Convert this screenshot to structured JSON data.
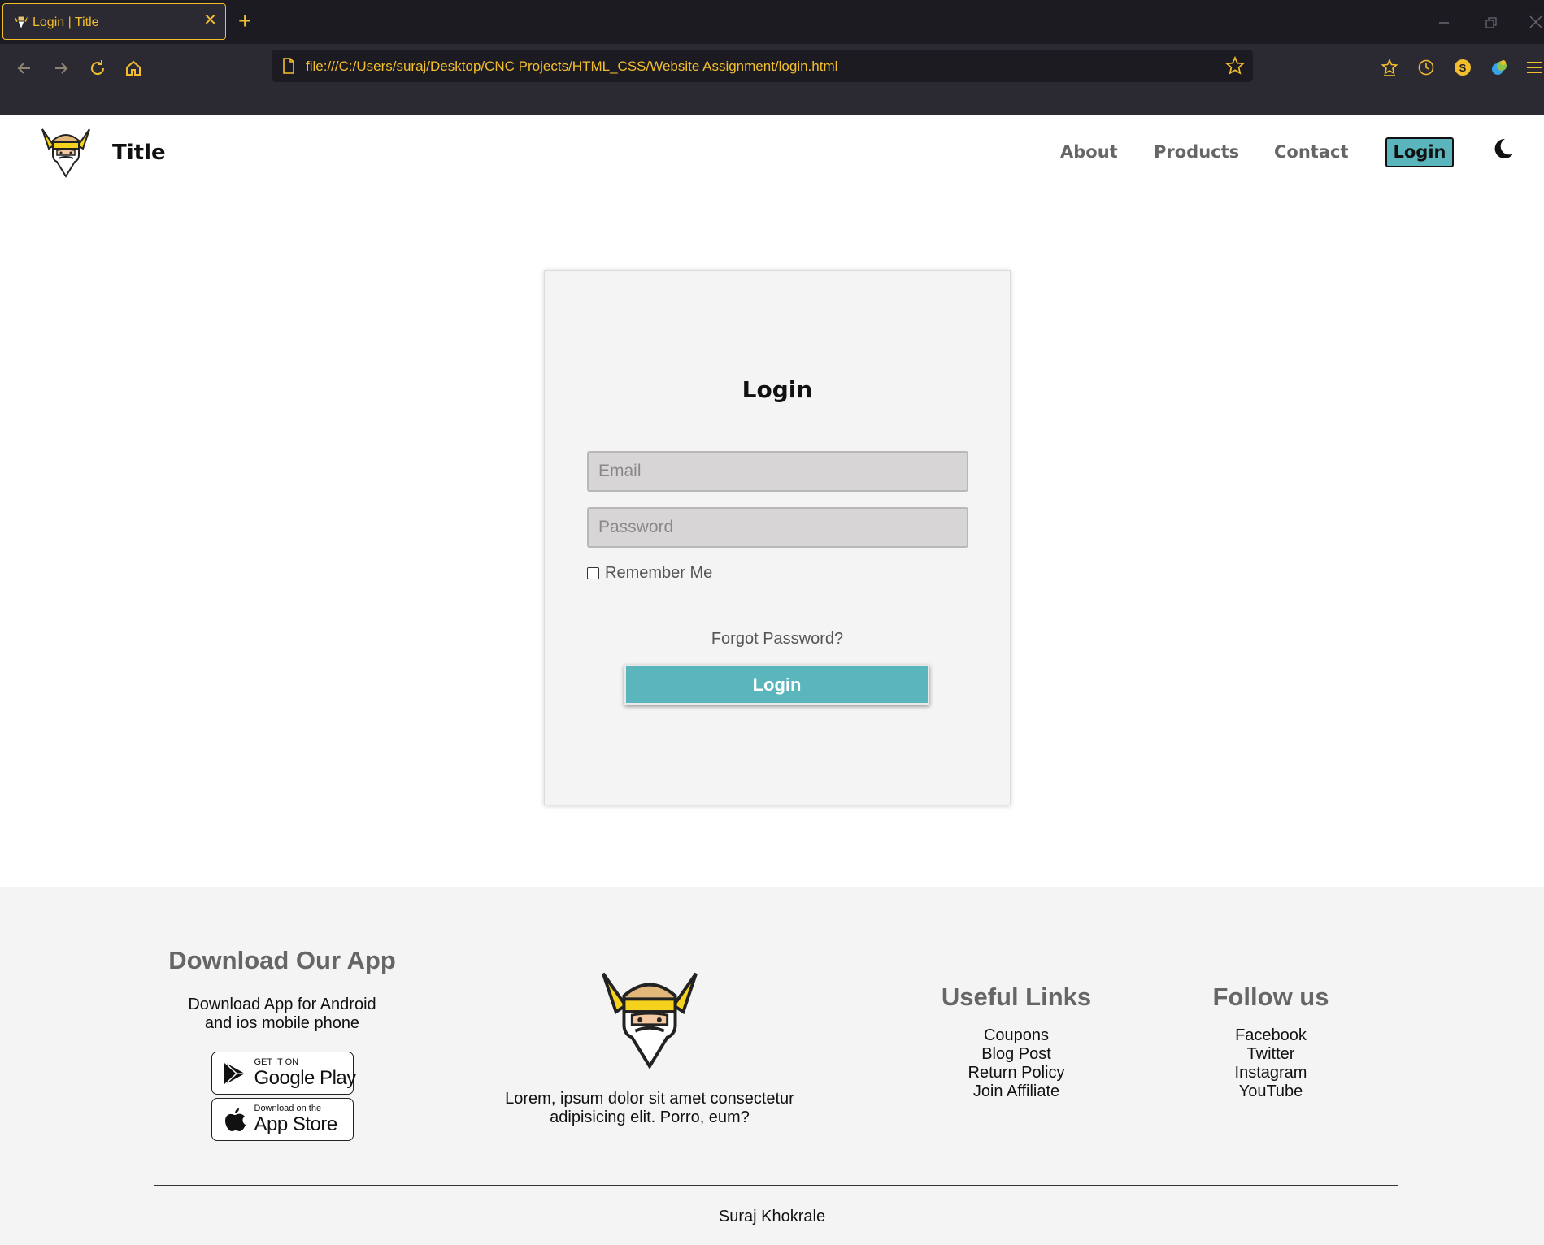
{
  "browser": {
    "tab_title": "Login | Title",
    "tab_close": "✕",
    "new_tab": "+",
    "url": "file:///C:/Users/suraj/Desktop/CNC Projects/HTML_CSS/Website Assignment/login.html",
    "accent_color": "#f3be2d"
  },
  "header": {
    "site_title": "Title",
    "nav": [
      "About",
      "Products",
      "Contact"
    ],
    "login_label": "Login"
  },
  "login_form": {
    "heading": "Login",
    "email_placeholder": "Email",
    "password_placeholder": "Password",
    "remember_label": "Remember Me",
    "forgot_label": "Forgot Password?",
    "submit_label": "Login",
    "accent_color": "#5bb5bd"
  },
  "footer": {
    "app": {
      "heading": "Download Our App",
      "text_line1": "Download App for Android",
      "text_line2": "and ios mobile phone",
      "google_small": "GET IT ON",
      "google_big": "Google Play",
      "apple_small": "Download on the",
      "apple_big": "App Store"
    },
    "about": {
      "text_line1": "Lorem, ipsum dolor sit amet consectetur",
      "text_line2": "adipisicing elit. Porro, eum?"
    },
    "useful_links": {
      "heading": "Useful Links",
      "items": [
        "Coupons",
        "Blog Post",
        "Return Policy",
        "Join Affiliate"
      ]
    },
    "follow": {
      "heading": "Follow us",
      "items": [
        "Facebook",
        "Twitter",
        "Instagram",
        "YouTube"
      ]
    },
    "credit": "Suraj Khokrale"
  }
}
